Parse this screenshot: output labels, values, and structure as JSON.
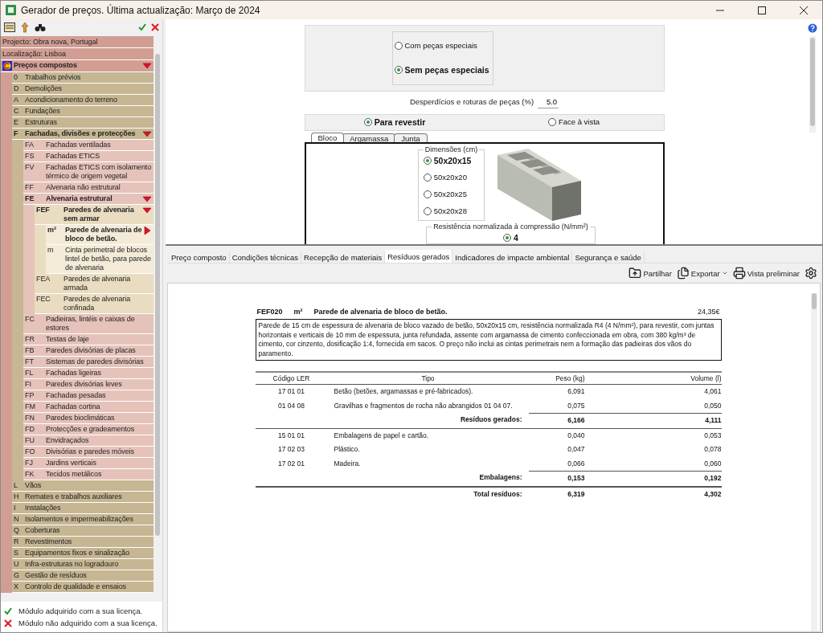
{
  "window": {
    "title": "Gerador de preços. Última actualização: Março de 2024"
  },
  "project_info": [
    "Projecto: Obra nova, Portugal",
    "Localização: Lisboa"
  ],
  "tree": [
    {
      "label": "Preços compostos",
      "expanded": true,
      "selected": false,
      "children": [
        {
          "code": "0",
          "label": "Trabalhos prévios",
          "expanded": false,
          "selected": false
        },
        {
          "code": "D",
          "label": "Demolições",
          "expanded": false,
          "selected": false
        },
        {
          "code": "A",
          "label": "Acondicionamento do terreno",
          "expanded": false,
          "selected": false
        },
        {
          "code": "C",
          "label": "Fundações",
          "expanded": false,
          "selected": false
        },
        {
          "code": "E",
          "label": "Estruturas",
          "expanded": false,
          "selected": false
        },
        {
          "code": "F",
          "label": "Fachadas, divisões e protecções",
          "expanded": true,
          "selected": false,
          "children": [
            {
              "code": "FA",
              "label": "Fachadas ventiladas",
              "expanded": false,
              "selected": false
            },
            {
              "code": "FS",
              "label": "Fachadas ETICS",
              "expanded": false,
              "selected": false
            },
            {
              "code": "FV",
              "label": "Fachadas ETICS com isolamento térmico de origem vegetal",
              "expanded": false,
              "selected": false
            },
            {
              "code": "FF",
              "label": "Alvenaria não estrutural",
              "expanded": false,
              "selected": false
            },
            {
              "code": "FE",
              "label": "Alvenaria estrutural",
              "expanded": true,
              "selected": false,
              "children": [
                {
                  "code": "FEF",
                  "label": "Paredes de alvenaria sem armar",
                  "expanded": true,
                  "selected": false,
                  "children": [
                    {
                      "code": "m²",
                      "label": "Parede de alvenaria de bloco de betão.",
                      "expanded": false,
                      "selected": true
                    },
                    {
                      "code": "m",
                      "label": "Cinta perimetral de blocos lintel de betão, para parede de alvenaria",
                      "expanded": false,
                      "selected": false
                    }
                  ]
                },
                {
                  "code": "FEA",
                  "label": "Paredes de alvenaria armada",
                  "expanded": false,
                  "selected": false
                },
                {
                  "code": "FEC",
                  "label": "Paredes de alvenaria confinada",
                  "expanded": false,
                  "selected": false
                }
              ]
            },
            {
              "code": "FC",
              "label": "Padieiras, lintéis e caixas de estores",
              "expanded": false,
              "selected": false
            },
            {
              "code": "FR",
              "label": "Testas de laje",
              "expanded": false,
              "selected": false
            },
            {
              "code": "FB",
              "label": "Paredes divisórias de placas",
              "expanded": false,
              "selected": false
            },
            {
              "code": "FT",
              "label": "Sistemas de paredes divisórias",
              "expanded": false,
              "selected": false
            },
            {
              "code": "FL",
              "label": "Fachadas ligeiras",
              "expanded": false,
              "selected": false
            },
            {
              "code": "FI",
              "label": "Paredes divisórias leves",
              "expanded": false,
              "selected": false
            },
            {
              "code": "FP",
              "label": "Fachadas pesadas",
              "expanded": false,
              "selected": false
            },
            {
              "code": "FM",
              "label": "Fachadas cortina",
              "expanded": false,
              "selected": false
            },
            {
              "code": "FN",
              "label": "Paredes bioclimáticas",
              "expanded": false,
              "selected": false
            },
            {
              "code": "FD",
              "label": "Protecções e gradeamentos",
              "expanded": false,
              "selected": false
            },
            {
              "code": "FU",
              "label": "Envidraçados",
              "expanded": false,
              "selected": false
            },
            {
              "code": "FO",
              "label": "Divisórias e paredes móveis",
              "expanded": false,
              "selected": false
            },
            {
              "code": "FJ",
              "label": "Jardins verticais",
              "expanded": false,
              "selected": false
            },
            {
              "code": "FK",
              "label": "Tecidos metálicos",
              "expanded": false,
              "selected": false
            }
          ]
        },
        {
          "code": "L",
          "label": "Vãos",
          "expanded": false,
          "selected": false
        },
        {
          "code": "H",
          "label": "Remates e trabalhos auxiliares",
          "expanded": false,
          "selected": false
        },
        {
          "code": "I",
          "label": "Instalações",
          "expanded": false,
          "selected": false
        },
        {
          "code": "N",
          "label": "Isolamentos e impermeabilizações",
          "expanded": false,
          "selected": false
        },
        {
          "code": "Q",
          "label": "Coberturas",
          "expanded": false,
          "selected": false
        },
        {
          "code": "R",
          "label": "Revestimentos",
          "expanded": false,
          "selected": false
        },
        {
          "code": "S",
          "label": "Equipamentos fixos e sinalização",
          "expanded": false,
          "selected": false
        },
        {
          "code": "U",
          "label": "Infra-estruturas no logradouro",
          "expanded": false,
          "selected": false
        },
        {
          "code": "G",
          "label": "Gestão de resíduos",
          "expanded": false,
          "selected": false
        },
        {
          "code": "X",
          "label": "Controlo de qualidade e ensaios",
          "expanded": false,
          "selected": false
        }
      ]
    }
  ],
  "legend": [
    {
      "kind": "acquired",
      "text": "Módulo adquirido com a sua licença."
    },
    {
      "kind": "not_acquired",
      "text": "Módulo não adquirido com a sua licença."
    }
  ],
  "options": {
    "piece_options": [
      {
        "label": "Com peças especiais",
        "selected": false
      },
      {
        "label": "Sem peças especiais",
        "selected": true
      }
    ],
    "waste_field": {
      "label": "Desperdícios e roturas de peças (%)",
      "value": "5.0"
    },
    "finish_options": [
      {
        "label": "Para revestir",
        "selected": true
      },
      {
        "label": "Face à vista",
        "selected": false
      }
    ],
    "subtabs": [
      {
        "label": "Bloco",
        "selected": true
      },
      {
        "label": "Argamassa",
        "selected": false
      },
      {
        "label": "Junta",
        "selected": false
      }
    ],
    "dimensions": {
      "title": "Dimensões (cm)",
      "options": [
        {
          "label": "50x20x15",
          "selected": true
        },
        {
          "label": "50x20x20",
          "selected": false
        },
        {
          "label": "50x20x25",
          "selected": false
        },
        {
          "label": "50x20x28",
          "selected": false
        }
      ]
    },
    "resistance": {
      "title": "Resistência normalizada à compressão (N/mm²)",
      "options": [
        {
          "label": "4",
          "selected": true
        }
      ]
    }
  },
  "detail_tabs": [
    {
      "label": "Preço composto",
      "selected": false
    },
    {
      "label": "Condições técnicas",
      "selected": false
    },
    {
      "label": "Recepção de materiais",
      "selected": false
    },
    {
      "label": "Resíduos gerados",
      "selected": true
    },
    {
      "label": "Indicadores de impacte ambiental",
      "selected": false
    },
    {
      "label": "Segurança e saúde",
      "selected": false
    }
  ],
  "report_toolbar": [
    {
      "kind": "share",
      "label": "Partilhar"
    },
    {
      "kind": "export",
      "label": "Exportar"
    },
    {
      "kind": "preview",
      "label": "Vista preliminar"
    },
    {
      "kind": "settings"
    }
  ],
  "report": {
    "code": "FEF020",
    "unit": "m²",
    "title": "Parede de alvenaria de bloco de betão.",
    "price": "24,35€",
    "description": "Parede de 15 cm de espessura de alvenaria de bloco vazado de betão, 50x20x15 cm, resistência normalizada R4 (4 N/mm²), para revestir, com juntas horizontais e verticais de 10 mm de espessura, junta refundada, assente com argamassa de cimento confeccionada em obra, com 380 kg/m³ de cimento, cor cinzento, dosificação 1:4, fornecida em sacos. O preço não inclui as cintas perimetrais nem a formação das padieiras dos vãos do paramento.",
    "columns": [
      "Código LER",
      "Tipo",
      "Peso (kg)",
      "Volume (l)"
    ],
    "rows": [
      {
        "kind": "item",
        "code": "17 01 01",
        "type": "Betão (betões, argamassas e pré-fabricados).",
        "weight": "6,091",
        "volume": "4,061"
      },
      {
        "kind": "item",
        "code": "01 04 08",
        "type": "Gravilhas e fragmentos de rocha não abrangidos 01 04 07.",
        "weight": "0,075",
        "volume": "0,050"
      },
      {
        "kind": "subtotal",
        "label": "Resíduos gerados:",
        "weight": "6,166",
        "volume": "4,111"
      },
      {
        "kind": "item",
        "code": "15 01 01",
        "type": "Embalagens de papel e cartão.",
        "weight": "0,040",
        "volume": "0,053"
      },
      {
        "kind": "item",
        "code": "17 02 03",
        "type": "Plástico.",
        "weight": "0,047",
        "volume": "0,078"
      },
      {
        "kind": "item",
        "code": "17 02 01",
        "type": "Madeira.",
        "weight": "0,066",
        "volume": "0,060"
      },
      {
        "kind": "subtotal",
        "label": "Embalagens:",
        "weight": "0,153",
        "volume": "0,192"
      },
      {
        "kind": "total",
        "label": "Total resíduos:",
        "weight": "6,319",
        "volume": "4,302"
      }
    ]
  }
}
